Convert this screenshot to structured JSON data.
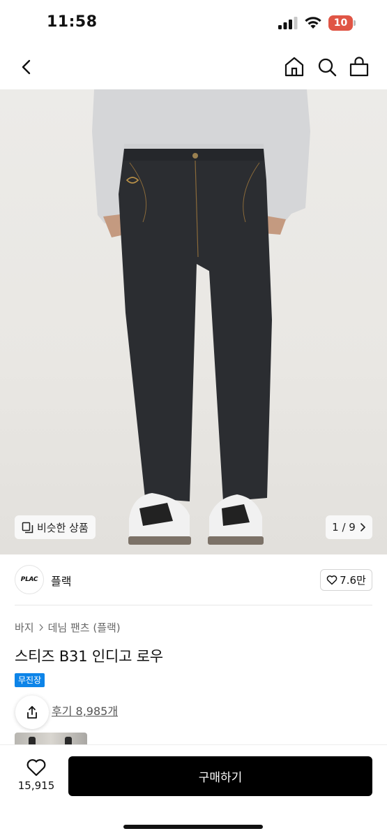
{
  "status_bar": {
    "time": "11:58",
    "battery": "10"
  },
  "nav": {
    "icons": [
      "chevron-left-icon",
      "home-icon",
      "search-icon",
      "shopping-bag-icon"
    ]
  },
  "hero": {
    "similar_label": "비슷한 상품",
    "page_indicator": "1 / 9"
  },
  "brand": {
    "logo_text": "PLAC",
    "name": "플랙",
    "likes": "7.6만"
  },
  "product": {
    "breadcrumb": [
      "바지",
      "데님 팬츠 (플랙)"
    ],
    "title": "스티즈 B31 인디고 로우",
    "badge": "무진장",
    "reviews": "후기 8,985개"
  },
  "bottom": {
    "wish_count": "15,915",
    "buy_label": "구매하기"
  },
  "colors": {
    "badge": "#0d84e8",
    "buy_button": "#000000",
    "battery": "#e05545"
  }
}
